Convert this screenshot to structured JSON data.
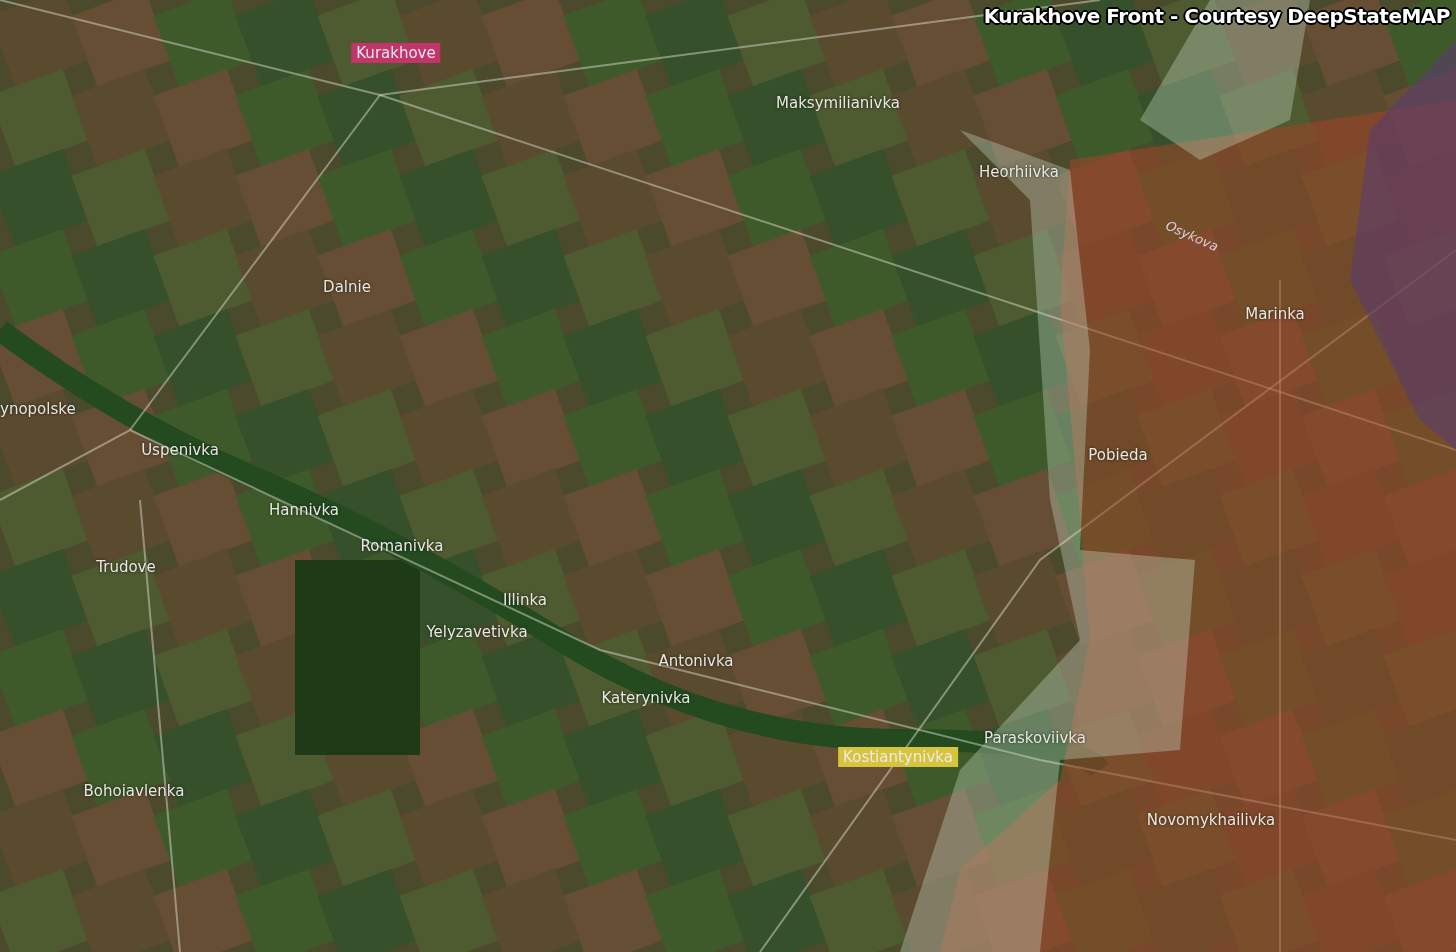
{
  "title": "Kurakhove Front - Courtesy DeepStateMAP",
  "labels": [
    {
      "text": "Kurakhove",
      "kind": "badge",
      "color": "#c2346c"
    },
    {
      "text": "Maksymilianivka",
      "kind": "plain"
    },
    {
      "text": "Heorhiivka",
      "kind": "plain"
    },
    {
      "text": "Osykova",
      "kind": "river"
    },
    {
      "text": "Marinka",
      "kind": "plain"
    },
    {
      "text": "Dalnie",
      "kind": "plain"
    },
    {
      "text": "ynopolske",
      "kind": "plain"
    },
    {
      "text": "Uspenivka",
      "kind": "plain"
    },
    {
      "text": "Hannivka",
      "kind": "plain"
    },
    {
      "text": "Romanivka",
      "kind": "plain"
    },
    {
      "text": "Trudove",
      "kind": "plain"
    },
    {
      "text": "Illinka",
      "kind": "plain"
    },
    {
      "text": "Yelyzavetivka",
      "kind": "plain"
    },
    {
      "text": "Antonivka",
      "kind": "plain"
    },
    {
      "text": "Katerynivka",
      "kind": "plain"
    },
    {
      "text": "Pobieda",
      "kind": "plain"
    },
    {
      "text": "Paraskoviivka",
      "kind": "plain"
    },
    {
      "text": "Kostiantynivka",
      "kind": "badge",
      "color": "#d6c43c"
    },
    {
      "text": "Bohoiavlenka",
      "kind": "plain"
    },
    {
      "text": "Novomykhailivka",
      "kind": "plain"
    }
  ]
}
